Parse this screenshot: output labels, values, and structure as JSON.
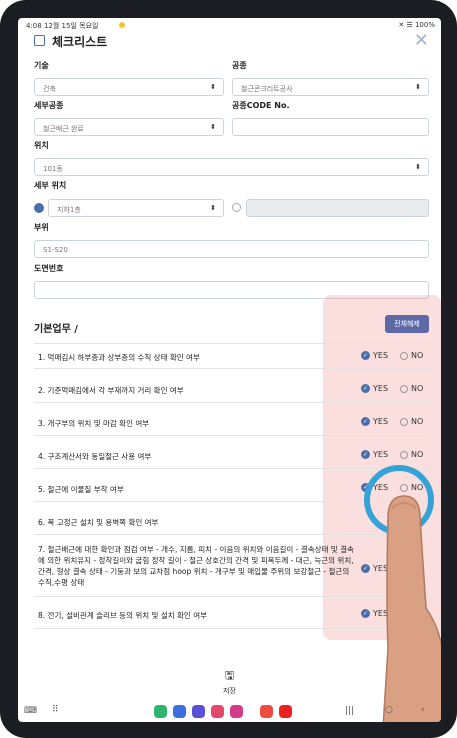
{
  "status": {
    "time": "4:08 12월 15일 목요일",
    "right": "✕ ☰ 100%"
  },
  "header": {
    "title": "체크리스트",
    "close_icon": "close-icon"
  },
  "form": {
    "tech_label": "기술",
    "tech_value": "건축",
    "trade_label": "공종",
    "trade_value": "철근콘크리트공사",
    "subtrade_label": "세부공종",
    "subtrade_value": "철근배근 완료",
    "code_label": "공종CODE No.",
    "code_value": "",
    "location_label": "위치",
    "location_value": "101동",
    "detail_label": "세부 위치",
    "detail_value": "지하1층",
    "detail_other": "",
    "part_label": "부위",
    "part_value": "S1-S20",
    "drawing_label": "도면번호",
    "drawing_value": ""
  },
  "section": {
    "title": "기본업무 /",
    "toggle_all": "전체해제"
  },
  "items": [
    {
      "text": "1. 먹매김시 하부층과 상부층의 수직 상태 확인 여부",
      "yes": "YES",
      "no": "NO"
    },
    {
      "text": "2. 기준먹매김에서 각 부재까지 거리 확인 여부",
      "yes": "YES",
      "no": "NO"
    },
    {
      "text": "3. 개구부의 위치 및 마감 확인 여부",
      "yes": "YES",
      "no": "NO"
    },
    {
      "text": "4. 구조계산서와 동일철근 사용 여부",
      "yes": "YES",
      "no": "NO"
    },
    {
      "text": "5. 철근에 이물질 부착 여부",
      "yes": "YES",
      "no": "NO"
    },
    {
      "text": "6. 폭 고정근 설치 및 용벽쪽 확인 여부",
      "yes": "",
      "no": ""
    },
    {
      "text": "7. 철근배근에 대한 확인과 점검 여부 - 개수, 지름, 피치 - 이음의 위치와 이음길이 - 결속상태 및 결속에 의한 위치유지 - 정착길이와 굽힘 정착 길이 - 철근 상호간의 간격 및 피복두께 - 대근, 늑근의 위치, 간격, 형상 결속 상태 - 기둥과 보의 교차점 hoop 위치 - 개구부 및 매입물 주위의 보강철근 - 철근의 수직,수평 상태",
      "yes": "YES",
      "no": ""
    },
    {
      "text": "8. 전기, 설비관계 슬리브 등의 위치 및 설치 확인 여부",
      "yes": "YES",
      "no": ""
    }
  ],
  "footer": {
    "save": "저장"
  },
  "colors": {
    "accent": "#4a6ea9",
    "button": "#5e6aa8",
    "overlay": "#f08080",
    "ring": "#36a3d6"
  }
}
